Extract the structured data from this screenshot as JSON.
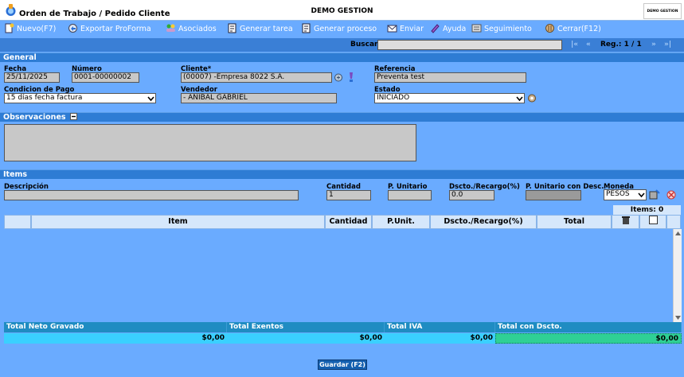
{
  "window": {
    "title": "Orden de Trabajo / Pedido Cliente",
    "app_name": "DEMO GESTION",
    "brand_box": "DEMO GESTION"
  },
  "toolbar": {
    "items": [
      {
        "label": "Nuevo(F7)",
        "icon": "new-doc-icon"
      },
      {
        "label": "Exportar ProForma",
        "icon": "export-icon"
      },
      {
        "label": "Asociados",
        "icon": "associates-icon"
      },
      {
        "label": "Generar tarea",
        "icon": "task-icon"
      },
      {
        "label": "Generar proceso",
        "icon": "process-icon"
      },
      {
        "label": "Enviar",
        "icon": "send-icon"
      },
      {
        "label": "Ayuda",
        "icon": "help-icon"
      },
      {
        "label": "Seguimiento",
        "icon": "tracking-icon"
      },
      {
        "label": "Cerrar(F12)",
        "icon": "close-icon"
      }
    ]
  },
  "search": {
    "label": "Buscar",
    "value": "",
    "nav_first": "|«",
    "nav_prev": "«",
    "reg_label": "Reg.: 1 / 1",
    "nav_next": "»",
    "nav_last": "»|"
  },
  "general": {
    "section_title": "General",
    "fecha": {
      "label": "Fecha",
      "value": "25/11/2025"
    },
    "numero": {
      "label": "Número",
      "value": "0001-00000002"
    },
    "cliente": {
      "label": "Cliente*",
      "value": "(00007) -Empresa 8022 S.A."
    },
    "referencia": {
      "label": "Referencia",
      "value": "Preventa test"
    },
    "condicion": {
      "label": "Condicion de Pago",
      "value": "15 días fecha factura"
    },
    "vendedor": {
      "label": "Vendedor",
      "value": "- ANIBAL GABRIEL"
    },
    "estado": {
      "label": "Estado",
      "value": "INICIADO"
    }
  },
  "observaciones": {
    "section_title": "Observaciones",
    "value": ""
  },
  "items": {
    "section_title": "Items",
    "descripcion": {
      "label": "Descripción",
      "value": ""
    },
    "cantidad": {
      "label": "Cantidad",
      "value": "1"
    },
    "p_unitario": {
      "label": "P. Unitario",
      "value": ""
    },
    "dscto": {
      "label": "Dscto./Recargo(%)",
      "value": "0.0"
    },
    "p_unitario_desc": {
      "label": "P. Unitario con Desc.",
      "value": ""
    },
    "moneda": {
      "label": "Moneda",
      "value": "PESOS"
    },
    "items_count": "Items: 0",
    "columns": [
      "Item",
      "Cantidad",
      "P.Unit.",
      "Dscto./Recargo(%)",
      "Total"
    ]
  },
  "totals": {
    "neto_label": "Total Neto Gravado",
    "neto_value": "$0,00",
    "exentos_label": "Total Exentos",
    "exentos_value": "$0,00",
    "iva_label": "Total IVA",
    "iva_value": "$0,00",
    "con_dscto_label": "Total con Dscto.",
    "con_dscto_value": "$0,00"
  },
  "actions": {
    "save_label": "Guardar (F2)"
  }
}
